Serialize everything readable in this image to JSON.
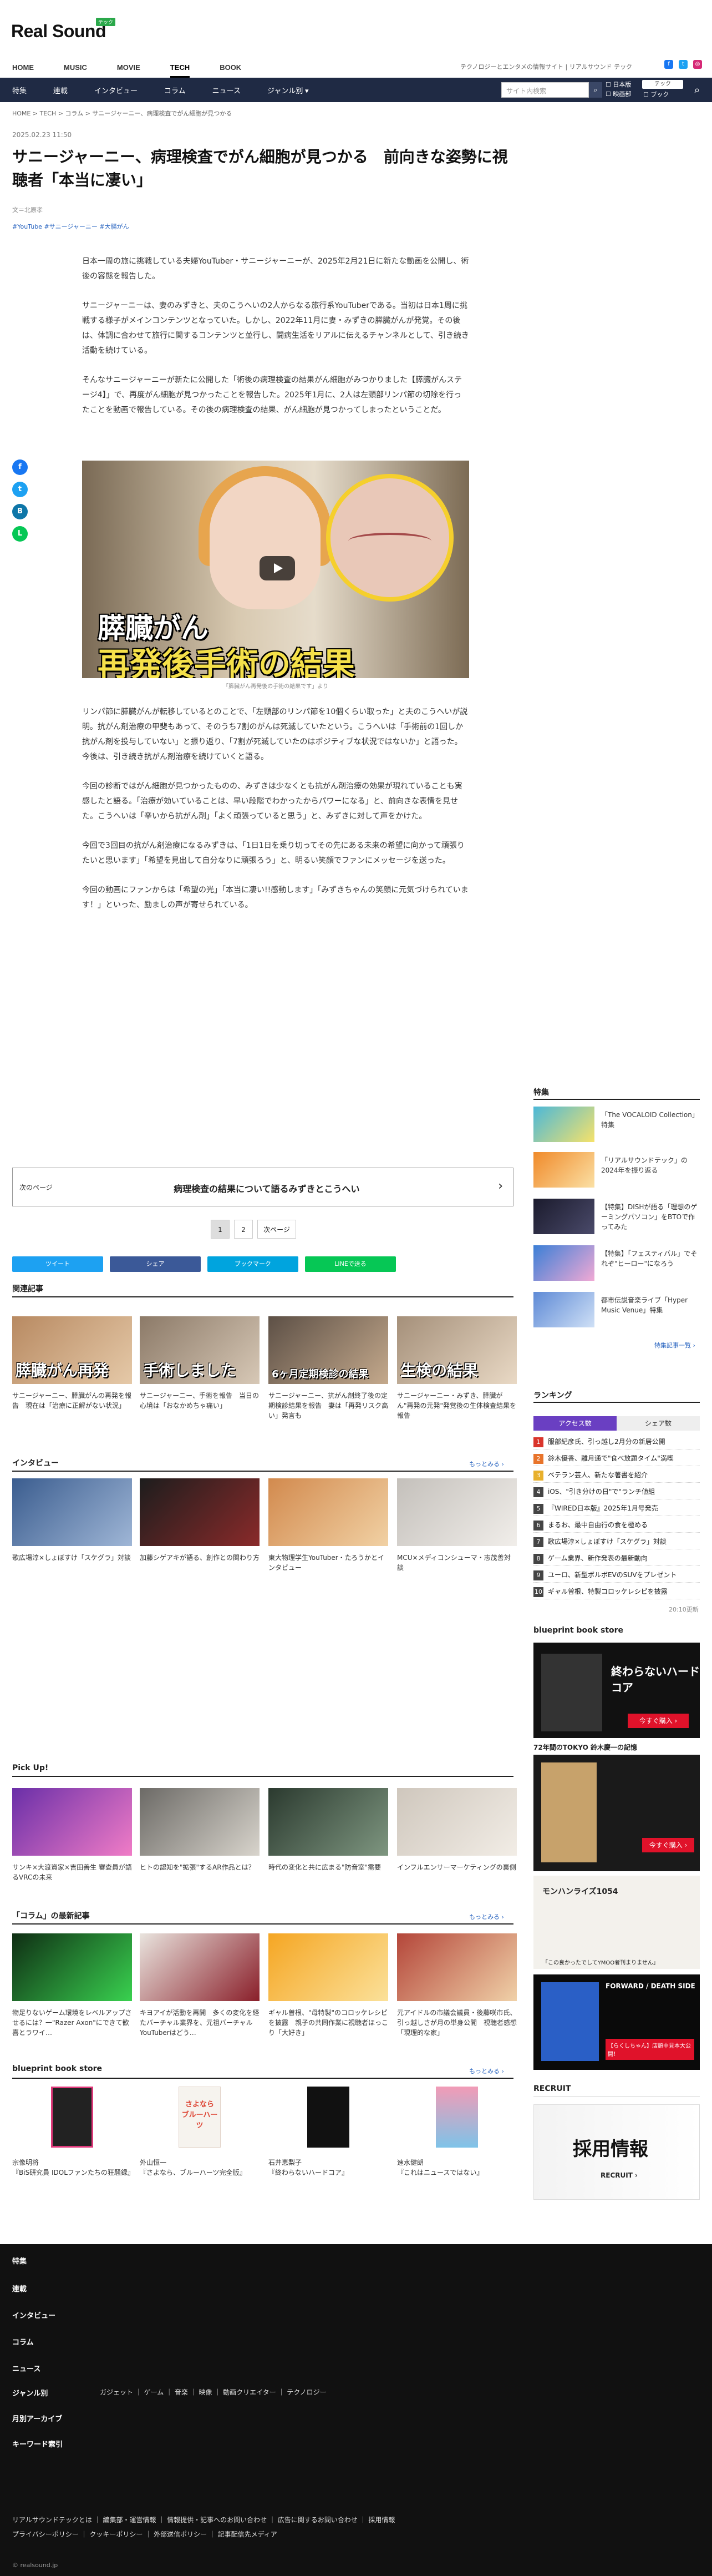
{
  "header": {
    "logo": "Real Sound",
    "logo_badge": "テック",
    "tagline": "テクノロジーとエンタメの情報サイト | リアルサウンド テック",
    "main_nav": [
      "HOME",
      "MUSIC",
      "MOVIE",
      "TECH",
      "BOOK"
    ],
    "active_nav": "TECH",
    "sub_nav": [
      "特集",
      "連載",
      "インタビュー",
      "コラム",
      "ニュース",
      "ジャンル別 ▾"
    ],
    "search_placeholder": "サイト内検索",
    "search_options": [
      "日本版",
      "映画部",
      "テック",
      "ブック"
    ]
  },
  "breadcrumb": "HOME  >  TECH  >  コラム  >  サニージャーニー、病理検査でがん細胞が見つかる",
  "article": {
    "date": "2025.02.23 11:50",
    "title": "サニージャーニー、病理検査でがん細胞が見つかる　前向きな姿勢に視聴者「本当に凄い」",
    "author": "文＝北原孝",
    "tags": "#YouTube  #サニージャーニー  #大腸がん",
    "paragraphs": [
      "日本一周の旅に挑戦している夫婦YouTuber・サニージャーニーが、2025年2月21日に新たな動画を公開し、術後の容態を報告した。",
      "サニージャーニーは、妻のみずきと、夫のこうへいの2人からなる旅行系YouTuberである。当初は日本1周に挑戦する様子がメインコンテンツとなっていた。しかし、2022年11月に妻・みずきの膵臓がんが発覚。その後は、体調に合わせて旅行に関するコンテンツと並行し、闘病生活をリアルに伝えるチャンネルとして、引き続き活動を続けている。",
      "そんなサニージャーニーが新たに公開した「術後の病理検査の結果がん細胞がみつかりました【膵臓がんステージ4】」で、再度がん細胞が見つかったことを報告した。2025年1月に、2人は左頸部リンパ節の切除を行ったことを動画で報告している。その後の病理検査の結果、がん細胞が見つかってしまったということだ。"
    ],
    "video_text_1": "膵臓がん",
    "video_text_2": "再発後手術の結果",
    "video_caption": "「膵臓がん再発後の手術の結果です」より",
    "paragraphs2": [
      "リンパ節に膵臓がんが転移しているとのことで、「左頸部のリンパ節を10個くらい取った」と夫のこうへいが説明。抗がん剤治療の甲斐もあって、そのうち7割のがんは死滅していたという。こうへいは「手術前の1回しか抗がん剤を投与していない」と振り返り、「7割が死滅していたのはポジティブな状況ではないか」と語った。今後は、引き続き抗がん剤治療を続けていくと語る。",
      "今回の診断ではがん細胞が見つかったものの、みずきは少なくとも抗がん剤治療の効果が現れていることも実感したと語る。「治療が効いていることは、早い段階でわかったからパワーになる」と、前向きな表情を見せた。こうへいは「辛いから抗がん剤」「よく頑張っていると思う」と、みずきに対して声をかけた。",
      "今回で3回目の抗がん剤治療になるみずきは、「1日1日を乗り切ってその先にある未来の希望に向かって頑張りたいと思います」「希望を見出して自分なりに頑張ろう」と、明るい笑顔でファンにメッセージを送った。",
      "今回の動画にファンからは「希望の光」「本当に凄い!!感動します」「みずきちゃんの笑顔に元気づけられています！」といった、励ましの声が寄せられている。"
    ]
  },
  "next_page": {
    "label": "次のページ",
    "title": "病理検査の結果について語るみずきとこうへい",
    "arrow": "›"
  },
  "pager": [
    "1",
    "2",
    "次ページ"
  ],
  "share_bar": [
    "ツイート",
    "シェア",
    "ブックマーク",
    "LINEで送る"
  ],
  "related": {
    "title": "関連記事",
    "items": [
      {
        "thumb": "膵臓がん再発",
        "caption": "サニージャーニー、膵臓がんの再発を報告　現在は「治療に正解がない状況」"
      },
      {
        "thumb": "手術しました",
        "caption": "サニージャーニー、手術を報告　当日の心境は「おなかめちゃ痛い」"
      },
      {
        "thumb": "6ヶ月定期検診の結果",
        "caption": "サニージャーニー、抗がん剤終了後の定期検診結果を報告　妻は「再発リスク高い」発言も"
      },
      {
        "thumb": "生検の結果",
        "caption": "サニージャーニー・みずき、膵臓がん\"再発の元発\"発覚後の生体検査結果を報告"
      }
    ]
  },
  "interview": {
    "title": "インタビュー",
    "more": "もっとみる ›",
    "items": [
      "歌広場淳×しょぼすけ「スケグラ」対談",
      "加藤シゲアキが語る、創作との関わり方",
      "東大物理学生YouTuber・たろうかとインタビュー",
      "MCU×メディコンシューマ・志茂善対談"
    ]
  },
  "pickup": {
    "title": "Pick Up!",
    "items": [
      "サンキ×大渡資家×吉田善生 審査員が語るVRCの未来",
      "ヒトの認知を\"拡張\"するAR作品とは？",
      "時代の変化と共に広まる\"防音室\"需要",
      "インフルエンサーマーケティングの裏側"
    ]
  },
  "column": {
    "title": "「コラム」の最新記事",
    "more": "もっとみる ›",
    "items": [
      "物足りないゲーム環境をレベルアップさせるには？一\"Razer Axon\"にできて歓喜とラワイ…",
      "キヨアイが活動を再開　多くの変化を経たバーチャル業界を、元祖バーチャルYouTuberはどう…",
      "ギャル曽根、\"母特製\"のコロッケレシピを披露　親子の共同作業に視聴者ほっこり「大好き」",
      "元アイドルの市議会議員・後藤咲市氏、引っ越しさが月の単身公開　視聴者感想「現理的な家」"
    ]
  },
  "bookstore": {
    "title": "blueprint book store",
    "more": "もっとみる ›",
    "items": [
      "宗像明将\n『BiS研究員 IDOLファンたちの狂騒録』",
      "外山恒一\n『さよなら、ブルーハーツ完全版』",
      "石井恵梨子\n『終わらないハードコア』",
      "速水健朗\n『これはニュースではない』"
    ]
  },
  "aside": {
    "feature_title": "特集",
    "features": [
      "「The VOCALOID Collection」特集",
      "「リアルサウンドテック」の2024年を振り返る",
      "【特集】DISHが語る「理想のゲーミングパソコン」をBTOで作ってみた",
      "【特集】「フェスティバル」でそれぞ\"ヒーロー\"になろう",
      "都市伝説音楽ライブ「Hyper Music Venue」特集"
    ],
    "feature_more": "特集記事一覧 ›",
    "ranking_title": "ランキング",
    "ranking_tabs": [
      "アクセス数",
      "シェア数"
    ],
    "ranking": [
      "服部紀彦氏、引っ越し2月分の新居公開",
      "鈴木優香、離月通で\"食べ放題タイム\"満喫",
      "ベテラン芸人、新たな著書を紹介",
      "iOS、\"引き分けの日\"で\"ランチ値組",
      "『WIRED日本版』2025年1月号発売",
      "まるお、最中自由行の食を極める",
      "歌広場淳×しょぼすけ「スケグラ」対談",
      "ゲーム業界、新作発表の最新動向",
      "ユーロ、新型ボルボEVのSUVをプレゼント",
      "ギャル曽根、特製コロッケレシピを披露"
    ],
    "ranking_time": "20:10更新",
    "book_title": "blueprint book store",
    "book_ad_1": "終わらないハードコア",
    "book_ad_1_sub": "72年間のTOKYO 鈴木慶一の記憶",
    "book_ad_2": "モンハンライズ1054",
    "book_ad_2_sub": "「この良かったでしてYMOO者刊まりません」",
    "book_ad_3": "FORWARD / DEATH SIDE",
    "book_ad_3_sub": "【らくしちゃん】店頭中見本大公開！",
    "recruit_title": "RECRUIT",
    "recruit_text": "採用情報",
    "recruit_sub": "RECRUIT ›"
  },
  "footer": {
    "items": [
      "特集",
      "連載",
      "インタビュー",
      "コラム",
      "ニュース",
      "ジャンル別",
      "月別アーカイブ",
      "キーワード索引"
    ],
    "genre_sub": "ガジェット ｜ ゲーム ｜ 音楽 ｜ 映像 ｜ 動画クリエイター ｜ テクノロジー",
    "links1": "リアルサウンドテックとは ｜ 編集部・運営情報 ｜ 情報提供・記事へのお問い合わせ ｜ 広告に関するお問い合わせ ｜ 採用情報",
    "links2": "プライバシーポリシー ｜ クッキーポリシー ｜ 外部送信ポリシー ｜ 記事配信先メディア",
    "copyright": "© realsound.jp"
  },
  "colors": {
    "navy": "#1f2a44",
    "accent": "#2aa84a",
    "link": "#2a65c0"
  }
}
